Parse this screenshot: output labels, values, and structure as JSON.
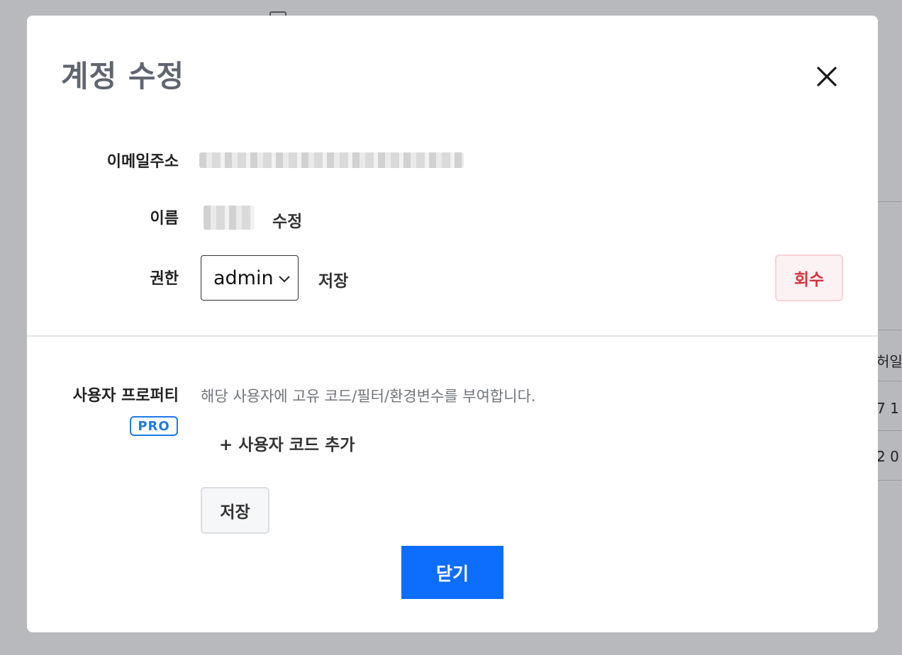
{
  "background": {
    "col_header_fragment": "허일시",
    "row1_fragment": "7 1",
    "row2_fragment": "2 0"
  },
  "modal": {
    "title": "계정 수정",
    "close_icon": "close-icon",
    "fields": {
      "email_label": "이메일주소",
      "name_label": "이름",
      "name_edit": "수정",
      "role_label": "권한",
      "role_value": "admin",
      "role_save": "저장",
      "revoke": "회수"
    },
    "properties": {
      "label": "사용자 프로퍼티",
      "badge": "PRO",
      "description": "해당 사용자에 고유 코드/필터/환경변수를 부여합니다.",
      "add_code": "+ 사용자 코드 추가",
      "save": "저장"
    },
    "close_button": "닫기"
  },
  "colors": {
    "primary": "#0d6efd",
    "danger": "#d9323f",
    "pro_badge": "#1e7ae6"
  }
}
